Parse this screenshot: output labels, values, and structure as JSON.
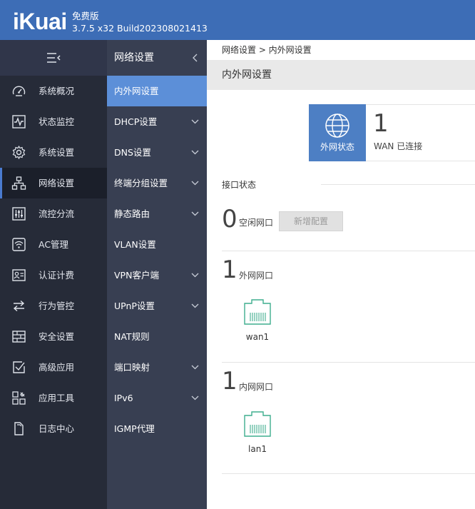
{
  "header": {
    "logo": "iKuai",
    "edition": "免费版",
    "version": "3.7.5 x32 Build202308021413",
    "bg_color": "#3d6db6"
  },
  "sidebar": {
    "toggle_icon": "menu-collapse-icon",
    "items": [
      {
        "label": "系统概况",
        "icon": "dashboard-icon"
      },
      {
        "label": "状态监控",
        "icon": "pulse-monitor-icon"
      },
      {
        "label": "系统设置",
        "icon": "gear-icon"
      },
      {
        "label": "网络设置",
        "icon": "network-topology-icon",
        "active": true
      },
      {
        "label": "流控分流",
        "icon": "sliders-icon"
      },
      {
        "label": "AC管理",
        "icon": "wifi-ap-icon"
      },
      {
        "label": "认证计费",
        "icon": "user-card-icon"
      },
      {
        "label": "行为管控",
        "icon": "swap-arrows-icon"
      },
      {
        "label": "安全设置",
        "icon": "firewall-icon"
      },
      {
        "label": "高级应用",
        "icon": "check-board-icon"
      },
      {
        "label": "应用工具",
        "icon": "tools-grid-icon"
      },
      {
        "label": "日志中心",
        "icon": "document-icon"
      }
    ]
  },
  "submenu": {
    "title": "网络设置",
    "items": [
      {
        "label": "内外网设置",
        "active": true,
        "expandable": false
      },
      {
        "label": "DHCP设置",
        "expandable": true
      },
      {
        "label": "DNS设置",
        "expandable": true
      },
      {
        "label": "终端分组设置",
        "expandable": true
      },
      {
        "label": "静态路由",
        "expandable": true
      },
      {
        "label": "VLAN设置",
        "expandable": false
      },
      {
        "label": "VPN客户端",
        "expandable": true
      },
      {
        "label": "UPnP设置",
        "expandable": true
      },
      {
        "label": "NAT规则",
        "expandable": false
      },
      {
        "label": "端口映射",
        "expandable": true
      },
      {
        "label": "IPv6",
        "expandable": true
      },
      {
        "label": "IGMP代理",
        "expandable": false
      }
    ]
  },
  "main": {
    "breadcrumb": "网络设置 > 内外网设置",
    "page_title": "内外网设置",
    "wan_status": {
      "label": "外网状态",
      "count": "1",
      "text": "WAN 已连接"
    },
    "interface_heading": "接口状态",
    "idle": {
      "count": "0",
      "label": "空闲网口",
      "add_button": "新增配置"
    },
    "wan_ports": {
      "count": "1",
      "label": "外网网口",
      "ports": [
        "wan1"
      ]
    },
    "lan_ports": {
      "count": "1",
      "label": "内网网口",
      "ports": [
        "lan1"
      ]
    },
    "port_color": "#3fae8e"
  }
}
